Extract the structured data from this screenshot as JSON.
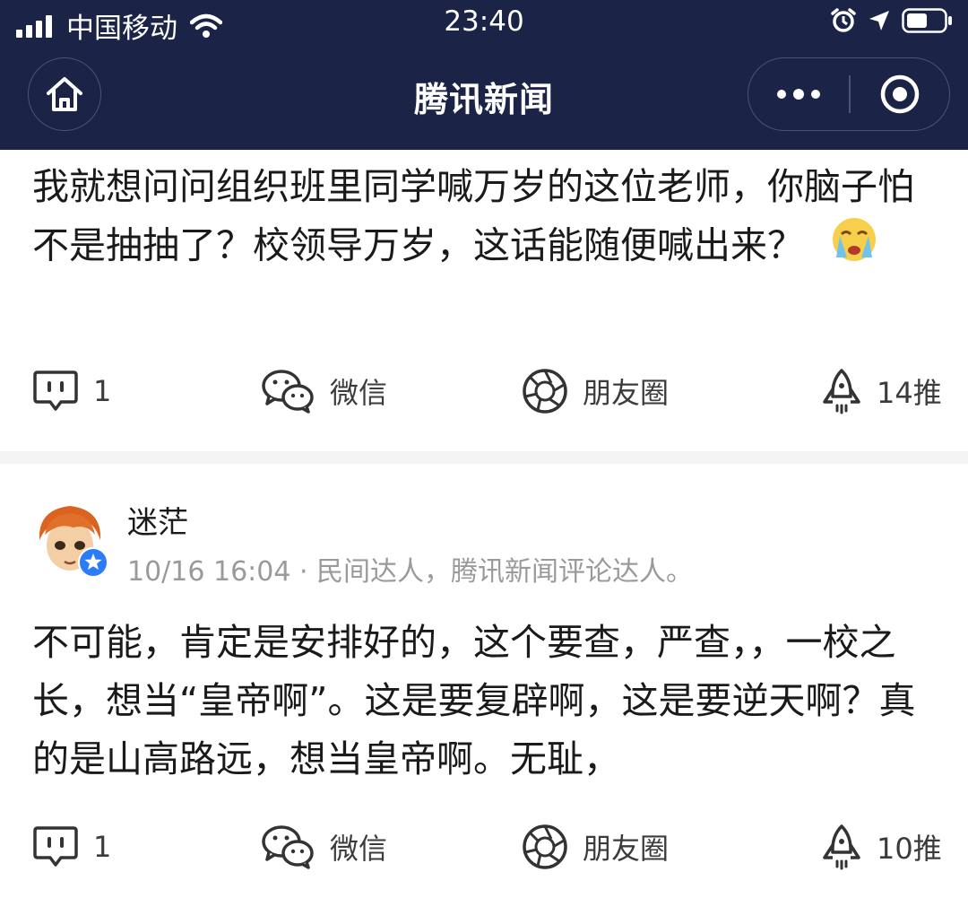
{
  "status_bar": {
    "carrier": "中国移动",
    "time": "23:40"
  },
  "nav": {
    "title": "腾讯新闻"
  },
  "comments": [
    {
      "text": "我就想问问组织班里同学喊万岁的这位老师，你脑子怕不是抽抽了？校领导万岁，这话能随便喊出来？",
      "emoji": "crying-face-emoji",
      "actions": {
        "reply_count": "1",
        "wechat": "微信",
        "moments": "朋友圈",
        "push": "14推"
      }
    },
    {
      "username": "迷茫",
      "meta": "10/16 16:04 · 民间达人，腾讯新闻评论达人。",
      "text": "不可能，肯定是安排好的，这个要查，严查，，一校之长，想当“皇帝啊”。这是要复辟啊，这是要逆天啊？真的是山高路远，想当皇帝啊。无耻，",
      "actions": {
        "reply_count": "1",
        "wechat": "微信",
        "moments": "朋友圈",
        "push": "10推"
      }
    }
  ],
  "colors": {
    "header_bg": "#1b2447",
    "text": "#1a1a1a",
    "meta_text": "#9a9a9a",
    "separator": "#f4f4f4",
    "badge": "#2b7cf6"
  }
}
